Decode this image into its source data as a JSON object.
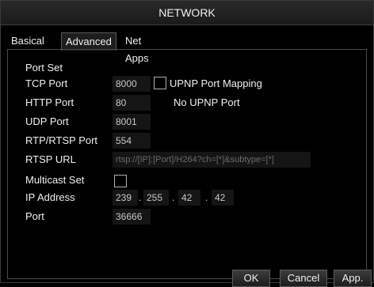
{
  "window": {
    "title": "NETWORK"
  },
  "tabs": [
    {
      "label": "Basical",
      "active": false
    },
    {
      "label": "Advanced",
      "active": true
    },
    {
      "label": "Net Apps",
      "active": false
    }
  ],
  "port_set": {
    "section_label": "Port Set",
    "tcp_port": {
      "label": "TCP Port",
      "value": "8000"
    },
    "upnp": {
      "label": "UPNP Port Mapping",
      "checked": false
    },
    "http_port": {
      "label": "HTTP Port",
      "value": "80",
      "status": "No UPNP Port"
    },
    "udp_port": {
      "label": "UDP Port",
      "value": "8001"
    },
    "rtp_rtsp_port": {
      "label": "RTP/RTSP Port",
      "value": "554"
    },
    "rtsp_url": {
      "label": "RTSP URL",
      "value": "rtsp://[IP]:[Port]/H264?ch=[*]&subtype=[*]"
    }
  },
  "multicast": {
    "section_label": "Multicast Set",
    "checked": false,
    "ip_address": {
      "label": "IP Address",
      "octets": [
        "239",
        "255",
        "42",
        "42"
      ]
    },
    "port": {
      "label": "Port",
      "value": "36666"
    }
  },
  "buttons": {
    "ok": "OK",
    "cancel": "Cancel",
    "apply": "App."
  },
  "colors": {
    "background": "#000000",
    "text": "#f0f0f0",
    "field_text": "#c8c8c8"
  }
}
